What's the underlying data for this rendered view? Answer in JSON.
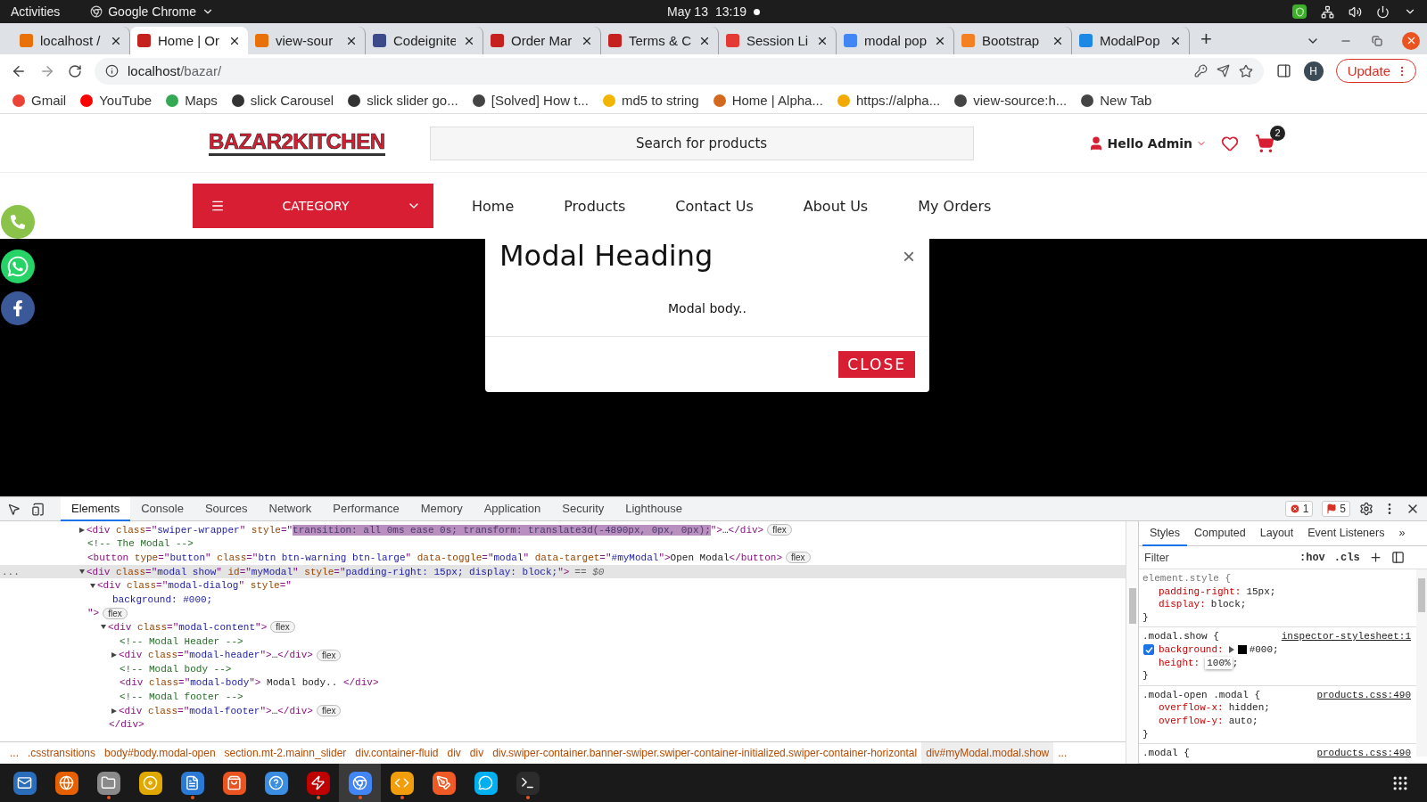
{
  "system_bar": {
    "activities": "Activities",
    "app": "Google Chrome",
    "date": "May 13",
    "time": "13:19"
  },
  "tabs": [
    {
      "title": "localhost /",
      "selected": false,
      "color": "#e8710a"
    },
    {
      "title": "Home | Or",
      "selected": true,
      "color": "#c5221f"
    },
    {
      "title": "view-sour",
      "selected": false,
      "color": "#e8710a"
    },
    {
      "title": "Codeignite",
      "selected": false,
      "color": "#3c4a8a"
    },
    {
      "title": "Order Mar",
      "selected": false,
      "color": "#c5221f"
    },
    {
      "title": "Terms & C",
      "selected": false,
      "color": "#c5221f"
    },
    {
      "title": "Session Li",
      "selected": false,
      "color": "#e53935"
    },
    {
      "title": "modal pop",
      "selected": false,
      "color": "#4285f4"
    },
    {
      "title": "Bootstrap",
      "selected": false,
      "color": "#f48024"
    },
    {
      "title": "ModalPop",
      "selected": false,
      "color": "#1e88e5"
    }
  ],
  "new_tab": "+",
  "address": {
    "host": "localhost",
    "path": "/bazar/"
  },
  "profile": "H",
  "update_button": "Update",
  "bookmarks": [
    {
      "label": "Gmail",
      "color": "#ea4335"
    },
    {
      "label": "YouTube",
      "color": "#ff0000"
    },
    {
      "label": "Maps",
      "color": "#34a853"
    },
    {
      "label": "slick Carousel",
      "color": "#333333"
    },
    {
      "label": "slick slider go...",
      "color": "#333333"
    },
    {
      "label": "[Solved] How t...",
      "color": "#444444"
    },
    {
      "label": "md5 to string",
      "color": "#f2b600"
    },
    {
      "label": "Home | Alpha...",
      "color": "#d2691e"
    },
    {
      "label": "https://alpha...",
      "color": "#f2a900"
    },
    {
      "label": "view-source:h...",
      "color": "#444444"
    },
    {
      "label": "New Tab",
      "color": "#444444"
    }
  ],
  "site": {
    "logo": "BAZAR2KITCHEN",
    "search": {
      "placeholder": "Search for products"
    },
    "account": "Hello Admin",
    "cart_count": "2",
    "category": "CATEGORY",
    "nav": [
      "Home",
      "Products",
      "Contact Us",
      "About Us",
      "My Orders"
    ]
  },
  "modal": {
    "title": "Modal Heading",
    "close": "×",
    "body": "Modal body..",
    "button": "CLOSE"
  },
  "devtools": {
    "tabs": [
      {
        "label": "Elements",
        "selected": true
      },
      {
        "label": "Console",
        "selected": false
      },
      {
        "label": "Sources",
        "selected": false
      },
      {
        "label": "Network",
        "selected": false
      },
      {
        "label": "Performance",
        "selected": false
      },
      {
        "label": "Memory",
        "selected": false
      },
      {
        "label": "Application",
        "selected": false
      },
      {
        "label": "Security",
        "selected": false
      },
      {
        "label": "Lighthouse",
        "selected": false
      }
    ],
    "errors": "1",
    "issues": "5",
    "dom": [
      {
        "selected": false,
        "expanded": false,
        "lines": [
          [
            {
              "kind": "tag",
              "text": "<div "
            },
            {
              "kind": "attr",
              "text": "class"
            },
            {
              "kind": "tag",
              "text": "=\""
            },
            {
              "kind": "val",
              "text": "swiper-wrapper"
            },
            {
              "kind": "tag",
              "text": "\" "
            },
            {
              "kind": "attr",
              "text": "style"
            },
            {
              "kind": "tag",
              "text": "=\""
            },
            {
              "kind": "hl",
              "text": "transition: all 0ms ease 0s; transform: translate3d(-4890px, 0px, 0px);"
            },
            {
              "kind": "tag",
              "text": "\">"
            },
            {
              "kind": "text",
              "text": "…"
            },
            {
              "kind": "tag",
              "text": "</div>"
            },
            {
              "kind": "badge",
              "text": "flex"
            }
          ]
        ]
      },
      {
        "selected": false,
        "lines": [
          [
            {
              "kind": "comment",
              "text": "<!-- The Modal -->"
            }
          ]
        ]
      },
      {
        "selected": false,
        "lines": [
          [
            {
              "kind": "tag",
              "text": "<button "
            },
            {
              "kind": "attr",
              "text": "type"
            },
            {
              "kind": "tag",
              "text": "=\""
            },
            {
              "kind": "val",
              "text": "button"
            },
            {
              "kind": "tag",
              "text": "\" "
            },
            {
              "kind": "attr",
              "text": "class"
            },
            {
              "kind": "tag",
              "text": "=\""
            },
            {
              "kind": "val",
              "text": "btn btn-warning btn-large"
            },
            {
              "kind": "tag",
              "text": "\" "
            },
            {
              "kind": "attr",
              "text": "data-toggle"
            },
            {
              "kind": "tag",
              "text": "=\""
            },
            {
              "kind": "val",
              "text": "modal"
            },
            {
              "kind": "tag",
              "text": "\" "
            },
            {
              "kind": "attr",
              "text": "data-target"
            },
            {
              "kind": "tag",
              "text": "=\""
            },
            {
              "kind": "val",
              "text": "#myModal"
            },
            {
              "kind": "tag",
              "text": "\">"
            },
            {
              "kind": "text",
              "text": "Open Modal"
            },
            {
              "kind": "tag",
              "text": "</button>"
            },
            {
              "kind": "badge",
              "text": "flex"
            }
          ]
        ]
      },
      {
        "selected": true,
        "gutter": "...",
        "expanded": true,
        "lines": [
          [
            {
              "kind": "tag",
              "text": "<div "
            },
            {
              "kind": "attr",
              "text": "class"
            },
            {
              "kind": "tag",
              "text": "=\""
            },
            {
              "kind": "val",
              "text": "modal show"
            },
            {
              "kind": "tag",
              "text": "\" "
            },
            {
              "kind": "attr",
              "text": "id"
            },
            {
              "kind": "tag",
              "text": "=\""
            },
            {
              "kind": "val",
              "text": "myModal"
            },
            {
              "kind": "tag",
              "text": "\" "
            },
            {
              "kind": "attr",
              "text": "style"
            },
            {
              "kind": "tag",
              "text": "=\""
            },
            {
              "kind": "val",
              "text": "padding-right: 15px; display: block;"
            },
            {
              "kind": "tag",
              "text": "\">"
            },
            {
              "kind": "dim",
              "text": "== $0"
            }
          ]
        ],
        "children": [
          {
            "selected": false,
            "expanded": true,
            "lines": [
              [
                {
                  "kind": "tag",
                  "text": "<div "
                },
                {
                  "kind": "attr",
                  "text": "class"
                },
                {
                  "kind": "tag",
                  "text": "=\""
                },
                {
                  "kind": "val",
                  "text": "modal-dialog"
                },
                {
                  "kind": "tag",
                  "text": "\" "
                },
                {
                  "kind": "attr",
                  "text": "style"
                },
                {
                  "kind": "tag",
                  "text": "=\""
                }
              ],
              [
                {
                  "kind": "val",
                  "text": "background: #000;"
                }
              ],
              [
                {
                  "kind": "tag",
                  "text": "\">"
                },
                {
                  "kind": "badge",
                  "text": "flex"
                }
              ]
            ],
            "children": [
              {
                "selected": false,
                "expanded": true,
                "lines": [
                  [
                    {
                      "kind": "tag",
                      "text": "<div "
                    },
                    {
                      "kind": "attr",
                      "text": "class"
                    },
                    {
                      "kind": "tag",
                      "text": "=\""
                    },
                    {
                      "kind": "val",
                      "text": "modal-content"
                    },
                    {
                      "kind": "tag",
                      "text": "\">"
                    },
                    {
                      "kind": "badge",
                      "text": "flex"
                    }
                  ]
                ],
                "children": [
                  {
                    "selected": false,
                    "lines": [
                      [
                        {
                          "kind": "comment",
                          "text": "<!-- Modal Header -->"
                        }
                      ]
                    ]
                  },
                  {
                    "selected": false,
                    "expanded": false,
                    "lines": [
                      [
                        {
                          "kind": "tag",
                          "text": "<div "
                        },
                        {
                          "kind": "attr",
                          "text": "class"
                        },
                        {
                          "kind": "tag",
                          "text": "=\""
                        },
                        {
                          "kind": "val",
                          "text": "modal-header"
                        },
                        {
                          "kind": "tag",
                          "text": "\">"
                        },
                        {
                          "kind": "text",
                          "text": "…"
                        },
                        {
                          "kind": "tag",
                          "text": "</div>"
                        },
                        {
                          "kind": "badge",
                          "text": "flex"
                        }
                      ]
                    ]
                  },
                  {
                    "selected": false,
                    "lines": [
                      [
                        {
                          "kind": "comment",
                          "text": "<!-- Modal body -->"
                        }
                      ]
                    ]
                  },
                  {
                    "selected": false,
                    "lines": [
                      [
                        {
                          "kind": "tag",
                          "text": "<div "
                        },
                        {
                          "kind": "attr",
                          "text": "class"
                        },
                        {
                          "kind": "tag",
                          "text": "=\""
                        },
                        {
                          "kind": "val",
                          "text": "modal-body"
                        },
                        {
                          "kind": "tag",
                          "text": "\">"
                        },
                        {
                          "kind": "text",
                          "text": " Modal body.. "
                        },
                        {
                          "kind": "tag",
                          "text": "</div>"
                        }
                      ]
                    ]
                  },
                  {
                    "selected": false,
                    "lines": [
                      [
                        {
                          "kind": "comment",
                          "text": "<!-- Modal footer -->"
                        }
                      ]
                    ]
                  },
                  {
                    "selected": false,
                    "expanded": false,
                    "lines": [
                      [
                        {
                          "kind": "tag",
                          "text": "<div "
                        },
                        {
                          "kind": "attr",
                          "text": "class"
                        },
                        {
                          "kind": "tag",
                          "text": "=\""
                        },
                        {
                          "kind": "val",
                          "text": "modal-footer"
                        },
                        {
                          "kind": "tag",
                          "text": "\">"
                        },
                        {
                          "kind": "text",
                          "text": "…"
                        },
                        {
                          "kind": "tag",
                          "text": "</div>"
                        },
                        {
                          "kind": "badge",
                          "text": "flex"
                        }
                      ]
                    ]
                  }
                ],
                "close": "</div>"
              }
            ]
          }
        ]
      }
    ],
    "breadcrumbs": [
      {
        "label": "...",
        "selected": false
      },
      {
        "label": ".csstransitions",
        "selected": false
      },
      {
        "label": "body#body.modal-open",
        "selected": false
      },
      {
        "label": "section.mt-2.mainn_slider",
        "selected": false
      },
      {
        "label": "div.container-fluid",
        "selected": false
      },
      {
        "label": "div",
        "selected": false
      },
      {
        "label": "div",
        "selected": false
      },
      {
        "label": "div.swiper-container.banner-swiper.swiper-container-initialized.swiper-container-horizontal",
        "selected": false
      },
      {
        "label": "div#myModal.modal.show",
        "selected": true
      },
      {
        "label": "...",
        "selected": false
      }
    ],
    "styles_tabs": [
      {
        "label": "Styles",
        "selected": true
      },
      {
        "label": "Computed",
        "selected": false
      },
      {
        "label": "Layout",
        "selected": false
      },
      {
        "label": "Event Listeners",
        "selected": false
      }
    ],
    "styles_more": "»",
    "filter": {
      "placeholder": "Filter"
    },
    "hov": ":hov",
    "cls": ".cls",
    "rules": [
      {
        "selector": "element.style {",
        "kind": "inline",
        "props": [
          {
            "name": "padding-right:",
            "value": "15px;"
          },
          {
            "name": "display:",
            "value": "block;"
          }
        ],
        "close": "}"
      },
      {
        "selector": ".modal.show {",
        "kind": "rule",
        "source": "inspector-stylesheet:1",
        "props": [
          {
            "name": "background:",
            "value": "#000;",
            "checked": true,
            "swatch": true
          },
          {
            "name": "height:",
            "value": "100%",
            "after": ";",
            "editing": true
          }
        ],
        "close": "}"
      },
      {
        "selector": ".modal-open .modal {",
        "kind": "rule",
        "source": "products.css:490",
        "props": [
          {
            "name": "overflow-x:",
            "value": "hidden;"
          },
          {
            "name": "overflow-y:",
            "value": "auto;"
          }
        ],
        "close": "}"
      },
      {
        "selector": ".modal {",
        "kind": "rule",
        "source": "products.css:490"
      }
    ]
  },
  "taskbar": [
    {
      "kind": "mail",
      "running": false,
      "selected": false
    },
    {
      "kind": "globe",
      "running": false,
      "selected": false
    },
    {
      "kind": "folder",
      "running": true,
      "selected": false
    },
    {
      "kind": "disc",
      "running": false,
      "selected": false
    },
    {
      "kind": "document",
      "running": true,
      "selected": false
    },
    {
      "kind": "bag",
      "running": false,
      "selected": false
    },
    {
      "kind": "help",
      "running": false,
      "selected": false
    },
    {
      "kind": "zap",
      "running": true,
      "selected": false
    },
    {
      "kind": "browser",
      "running": true,
      "selected": true
    },
    {
      "kind": "code",
      "running": true,
      "selected": false
    },
    {
      "kind": "pen",
      "running": false,
      "selected": false
    },
    {
      "kind": "chat",
      "running": false,
      "selected": false
    },
    {
      "kind": "terminal",
      "running": true,
      "selected": false
    }
  ]
}
